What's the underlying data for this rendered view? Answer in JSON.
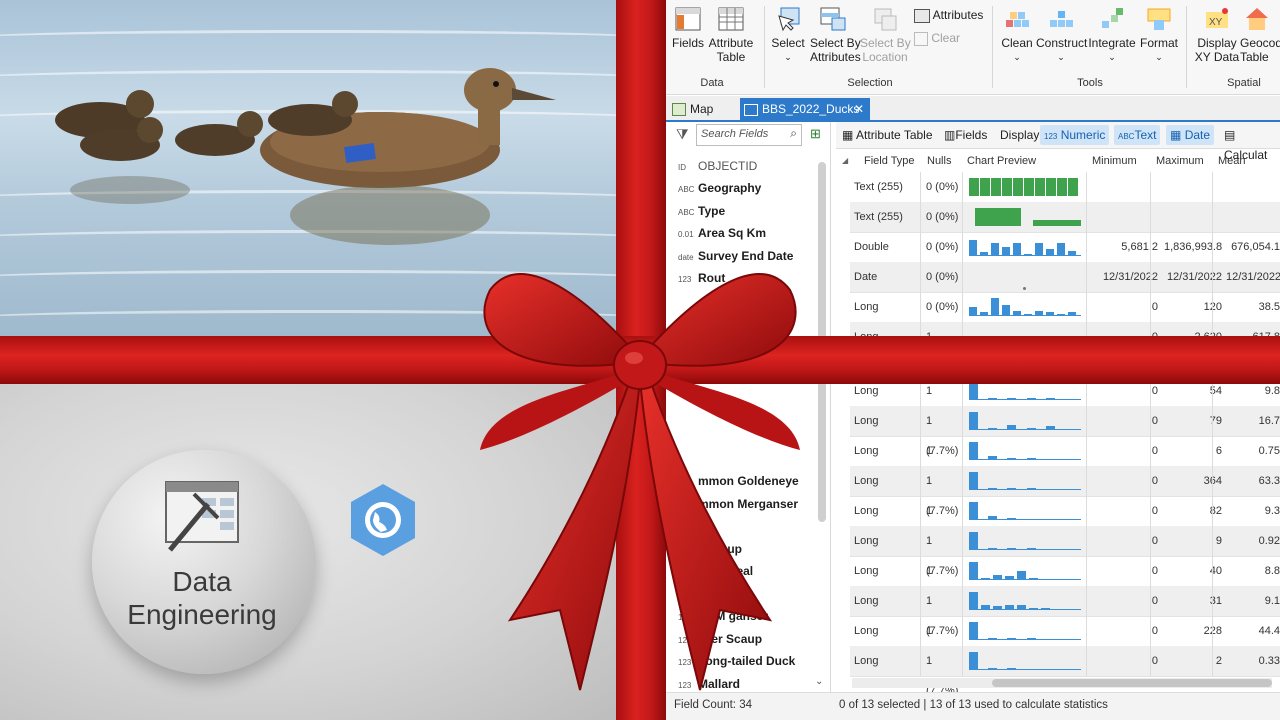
{
  "overlay": {
    "title_line1": "Data",
    "title_line2": "Engineering"
  },
  "ribbon": {
    "buttons": [
      {
        "label": "Fields",
        "icon": "fields-icon"
      },
      {
        "label": "Attribute\nTable",
        "icon": "attribute-table-icon"
      },
      {
        "label": "Select",
        "icon": "select-icon"
      },
      {
        "label": "Select By\nAttributes",
        "icon": "select-by-attributes-icon"
      },
      {
        "label": "Select By\nLocation",
        "icon": "select-by-location-icon"
      },
      {
        "label": "Attributes",
        "icon": "attributes-icon"
      },
      {
        "label": "Clear",
        "icon": "clear-icon"
      },
      {
        "label": "Clean",
        "icon": "clean-icon"
      },
      {
        "label": "Construct",
        "icon": "construct-icon"
      },
      {
        "label": "Integrate",
        "icon": "integrate-icon"
      },
      {
        "label": "Format",
        "icon": "format-icon"
      },
      {
        "label": "Display\nXY Data",
        "icon": "display-xy-data-icon"
      },
      {
        "label": "Geocod\nTable",
        "icon": "geocode-table-icon"
      }
    ],
    "groups": [
      "Data",
      "Selection",
      "Tools",
      "Spatial"
    ]
  },
  "tabs": {
    "map": "Map",
    "active": "BBS_2022_Ducks"
  },
  "fields_pane": {
    "search_placeholder": "Search Fields",
    "items": [
      {
        "name": "OBJECTID",
        "type": "ID"
      },
      {
        "name": "Geography",
        "type": "ABC"
      },
      {
        "name": "Type",
        "type": "ABC"
      },
      {
        "name": "Area Sq Km",
        "type": "0.01"
      },
      {
        "name": "Survey End Date",
        "type": "date"
      },
      {
        "name": "Rout",
        "type": "123"
      },
      {
        "name": "mmon Goldeneye",
        "type": "123"
      },
      {
        "name": "mmon Merganser",
        "type": "123"
      },
      {
        "name": "all",
        "type": "123"
      },
      {
        "name": "r Scaup",
        "type": "123"
      },
      {
        "name": "nged Teal",
        "type": "123"
      },
      {
        "name": "Duck",
        "type": "123"
      },
      {
        "name": "ed M  ganser",
        "type": "123"
      },
      {
        "name": "sser Scaup",
        "type": "123"
      },
      {
        "name": "Long-tailed Duck",
        "type": "123"
      },
      {
        "name": "Mallard",
        "type": "123"
      }
    ],
    "field_count": "Field Count: 34"
  },
  "table": {
    "toolbar": {
      "attribute_table": "Attribute Table",
      "fields": "Fields",
      "display": "Display:",
      "numeric": "Numeric",
      "text": "Text",
      "date": "Date",
      "calculate": "Calculat"
    },
    "headers": [
      "Field Type",
      "Nulls",
      "Chart Preview",
      "Minimum",
      "Maximum",
      "Mean"
    ],
    "rows": [
      {
        "type": "Text (255)",
        "nulls": "0 (0%)",
        "min": "",
        "max": "",
        "mean": "",
        "chart": "text-full"
      },
      {
        "type": "Text (255)",
        "nulls": "0 (0%)",
        "min": "",
        "max": "",
        "mean": "",
        "chart": "text-two"
      },
      {
        "type": "Double",
        "nulls": "0 (0%)",
        "min": "5,681.2",
        "max": "1,836,993.8",
        "mean": "676,054.1",
        "chart": [
          0.9,
          0.2,
          0.7,
          0.5,
          0.7,
          0.1,
          0.7,
          0.4,
          0.7,
          0.3
        ]
      },
      {
        "type": "Date",
        "nulls": "0 (0%)",
        "min": "12/31/2022",
        "max": "12/31/2022",
        "mean": "12/31/2022",
        "chart": "date"
      },
      {
        "type": "Long",
        "nulls": "0 (0%)",
        "min": "0",
        "max": "120",
        "mean": "38.5",
        "chart": [
          0.5,
          0.2,
          1,
          0.6,
          0.3,
          0.1,
          0.3,
          0.2,
          0.1,
          0.2
        ]
      },
      {
        "type": "Long",
        "nulls": "1 (7.7%)",
        "min": "0",
        "max": "2,620",
        "mean": "617.8",
        "chart": [
          0.4,
          0.3,
          0.2
        ]
      },
      {
        "type": "Long",
        "nulls": "1 (7.7%)",
        "min": "0",
        "max": "54",
        "mean": "9.8",
        "chart": [
          1,
          0.1,
          0.1,
          0.05,
          0.1
        ]
      },
      {
        "type": "Long",
        "nulls": "1 (7.7%)",
        "min": "0",
        "max": "79",
        "mean": "16.7",
        "chart": [
          1,
          0.1,
          0.3,
          0.1,
          0.2
        ]
      },
      {
        "type": "Long",
        "nulls": "1 (7.7%)",
        "min": "0",
        "max": "6",
        "mean": "0.75",
        "chart": [
          1,
          0.2,
          0.05,
          0.1
        ]
      },
      {
        "type": "Long",
        "nulls": "1 (7.7%)",
        "min": "0",
        "max": "364",
        "mean": "63.3",
        "chart": [
          1,
          0.1,
          0.1,
          0.05
        ]
      },
      {
        "type": "Long",
        "nulls": "1 (7.7%)",
        "min": "0",
        "max": "82",
        "mean": "9.3",
        "chart": [
          1,
          0.2,
          0.05
        ]
      },
      {
        "type": "Long",
        "nulls": "1 (7.7%)",
        "min": "0",
        "max": "9",
        "mean": "0.92",
        "chart": [
          1,
          0.1,
          0.1,
          0.05
        ]
      },
      {
        "type": "Long",
        "nulls": "1 (7.7%)",
        "min": "0",
        "max": "40",
        "mean": "8.8",
        "chart": [
          1,
          0.1,
          0.3,
          0.2,
          0.5,
          0.1
        ]
      },
      {
        "type": "Long",
        "nulls": "1 (7.7%)",
        "min": "0",
        "max": "31",
        "mean": "9.1",
        "chart": [
          1,
          0.3,
          0.2,
          0.3,
          0.3,
          0.1,
          0.1
        ]
      },
      {
        "type": "Long",
        "nulls": "1 (7.7%)",
        "min": "0",
        "max": "228",
        "mean": "44.4",
        "chart": [
          1,
          0.1,
          0.1,
          0.05
        ]
      },
      {
        "type": "Long",
        "nulls": "1 (7.7%)",
        "min": "0",
        "max": "2",
        "mean": "0.33",
        "chart": [
          1,
          0.1,
          0.05
        ]
      }
    ],
    "status": "0 of 13 selected | 13 of 13 used to calculate statistics"
  },
  "colors": {
    "ribbon_red": "#c8191a",
    "accent_blue": "#2c7ac9",
    "bar_blue": "#3a8fd6",
    "bar_green": "#3fa34d"
  }
}
